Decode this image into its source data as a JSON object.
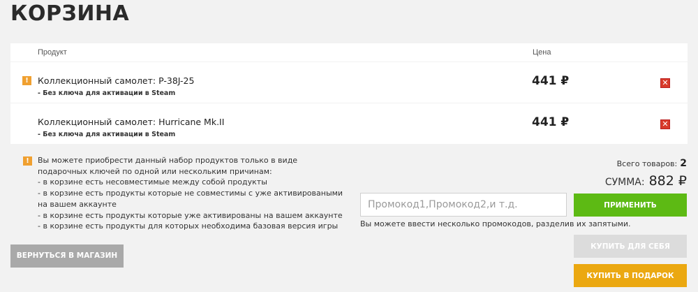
{
  "page": {
    "title": "КОРЗИНА"
  },
  "table": {
    "headers": {
      "product": "Продукт",
      "price": "Цена"
    },
    "rows": [
      {
        "warning_icon": "!",
        "name": "Коллекционный самолет: P-38J-25",
        "note": "- Без ключа для активации в Steam",
        "price": "441 ₽",
        "remove_icon": "✕",
        "has_warning": true
      },
      {
        "warning_icon": "",
        "name": "Коллекционный самолет: Hurricane Mk.II",
        "note": "- Без ключа для активации в Steam",
        "price": "441 ₽",
        "remove_icon": "✕",
        "has_warning": false
      }
    ]
  },
  "notice": {
    "icon": "!",
    "lines": [
      "Вы можете приобрести данный набор продуктов только в виде",
      "подарочных ключей по одной или нескольким причинам:",
      "- в корзине есть несовместимые между собой продукты",
      "- в корзине есть продукты которые не совместимы с уже активироваными",
      "на вашем аккаунте",
      "- в корзине есть продукты которые уже активированы на вашем аккаунте",
      "- в корзине есть продукты для которых необходима базовая версия игры"
    ]
  },
  "summary": {
    "total_label": "Всего товаров:",
    "total_count": "2",
    "sum_label": "СУММА:",
    "sum_value": "882 ₽"
  },
  "promo": {
    "placeholder": "Промокод1,Промокод2,и т.д.",
    "value": "",
    "apply_label": "ПРИМЕНИТЬ",
    "hint": "Вы можете ввести несколько промокодов, разделив их запятыми."
  },
  "buttons": {
    "back": "ВЕРНУТЬСЯ В МАГАЗИН",
    "buy_self": "КУПИТЬ ДЛЯ СЕБЯ",
    "buy_gift": "КУПИТЬ В ПОДАРОК"
  },
  "colors": {
    "warning": "#f0a030",
    "remove": "#d83a2a",
    "apply": "#5dba14",
    "gift": "#eba811",
    "disabled": "#dcdcdc",
    "back": "#a9a9a9"
  }
}
